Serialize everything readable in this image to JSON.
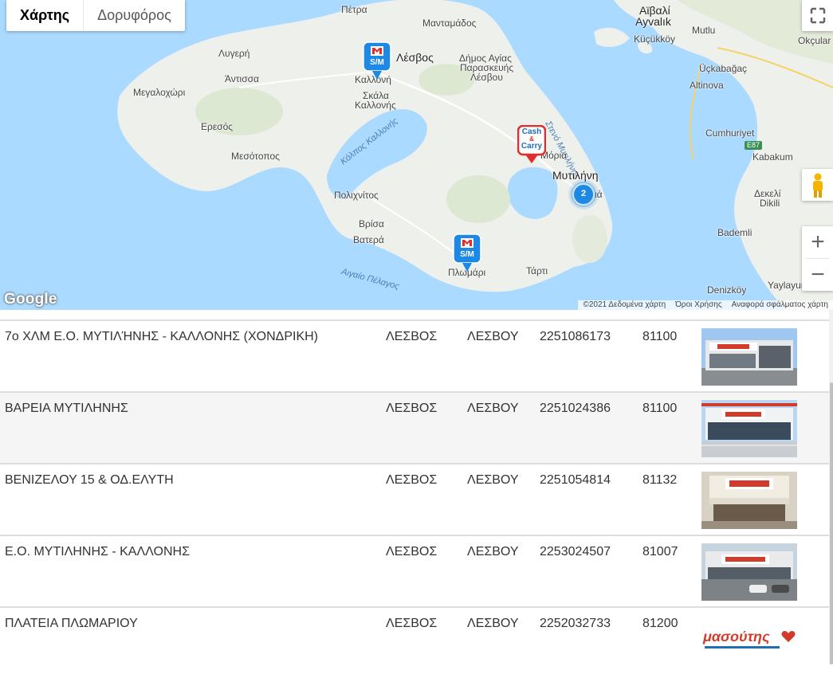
{
  "map": {
    "type_buttons": {
      "map": "Χάρτης",
      "satellite": "Δορυφόρος"
    },
    "labels": {
      "petra": "Πέτρα",
      "mantamados": "Μανταμάδος",
      "aivali": "Ayvalık",
      "aivali_gr": "Αϊβαλί",
      "mutlu": "Mutlu",
      "kucukkoy": "Küçükköy",
      "okcular": "Okçular",
      "lygeri": "Λυγερή",
      "lesvos": "Λέσβος",
      "agiaparaskevi1": "Δήμος Αγίας",
      "agiaparaskevi2": "Παρασκευής",
      "agiaparaskevi3": "Λέσβου",
      "ucka": "Üçkabağaç",
      "antissa": "Άντισσα",
      "kalloni": "Καλλονή",
      "altinova": "Altinova",
      "megalochori": "Μεγαλοχώρι",
      "skala1": "Σκάλα",
      "skala2": "Καλλονής",
      "steno": "Στενό Μυτιλήνης",
      "eresos": "Ερεσός",
      "kolpos": "Κόλπος Καλλονής",
      "cumhuriyet": "Cumhuriyet",
      "e87": "E87",
      "mesotopos": "Μεσότοπος",
      "moria": "Μόρια",
      "kabakum": "Kabakum",
      "mytilini": "Μυτιλήνη",
      "polichnitos": "Πολιχνίτος",
      "dikeli_gr": "Δεκελί",
      "dikeli": "Dikili",
      "vrisa": "Βρίσα",
      "vatera": "Βατερά",
      "bademli": "Bademli",
      "plomari": "Πλωμάρι",
      "tarti": "Τάρτι",
      "aigaio": "Αιγαίο Πέλαγος",
      "denizkoy": "Denizköy",
      "yaylayurt": "Yaylayurt",
      "vareia_partial": "ιά"
    },
    "markers": [
      {
        "name": "sm-marker-kalloni",
        "label": "S/M"
      },
      {
        "name": "cash-carry-marker",
        "label1": "Cash",
        "label2": "&",
        "label3": "Carry"
      },
      {
        "name": "sm-marker-plomari",
        "label": "S/M"
      }
    ],
    "cluster_count": "2",
    "logo": "Google",
    "footer": {
      "copyright": "©2021 Δεδομένα χάρτη",
      "terms": "Όροι Χρήσης",
      "report": "Αναφορά σφάλματος χάρτη"
    },
    "colors": {
      "water": "#aadaff",
      "land": "#eef0eb",
      "marker_blue": "#1e88e5",
      "marker_red": "#e32b2b"
    }
  },
  "stores": [
    {
      "address": "7ο ΧΛΜ Ε.Ο. ΜΥΤΙΛΉΝΗΣ - ΚΑΛΛΟΝΗΣ (ΧΟΝΔΡΙΚΗ)",
      "region": "ΛΕΣΒΟΣ",
      "area": "ΛΕΣΒΟΥ",
      "phone": "2251086173",
      "zip": "81100"
    },
    {
      "address": "ΒΑΡΕΙΑ ΜΥΤΙΛΗΝΗΣ",
      "region": "ΛΕΣΒΟΣ",
      "area": "ΛΕΣΒΟΥ",
      "phone": "2251024386",
      "zip": "81100"
    },
    {
      "address": "ΒΕΝΙΖΕΛΟΥ 15 & ΟΔ.ΕΛΥΤΗ",
      "region": "ΛΕΣΒΟΣ",
      "area": "ΛΕΣΒΟΥ",
      "phone": "2251054814",
      "zip": "81132"
    },
    {
      "address": "Ε.Ο. ΜΥΤΙΛΗΝΗΣ - ΚΑΛΛΟΝΗΣ",
      "region": "ΛΕΣΒΟΣ",
      "area": "ΛΕΣΒΟΥ",
      "phone": "2253024507",
      "zip": "81007"
    },
    {
      "address": "ΠΛΑΤΕΙΑ ΠΛΩΜΑΡΙΟΥ",
      "region": "ΛΕΣΒΟΣ",
      "area": "ΛΕΣΒΟΥ",
      "phone": "2252032733",
      "zip": "81200"
    }
  ],
  "logo_text": "μασούτης"
}
